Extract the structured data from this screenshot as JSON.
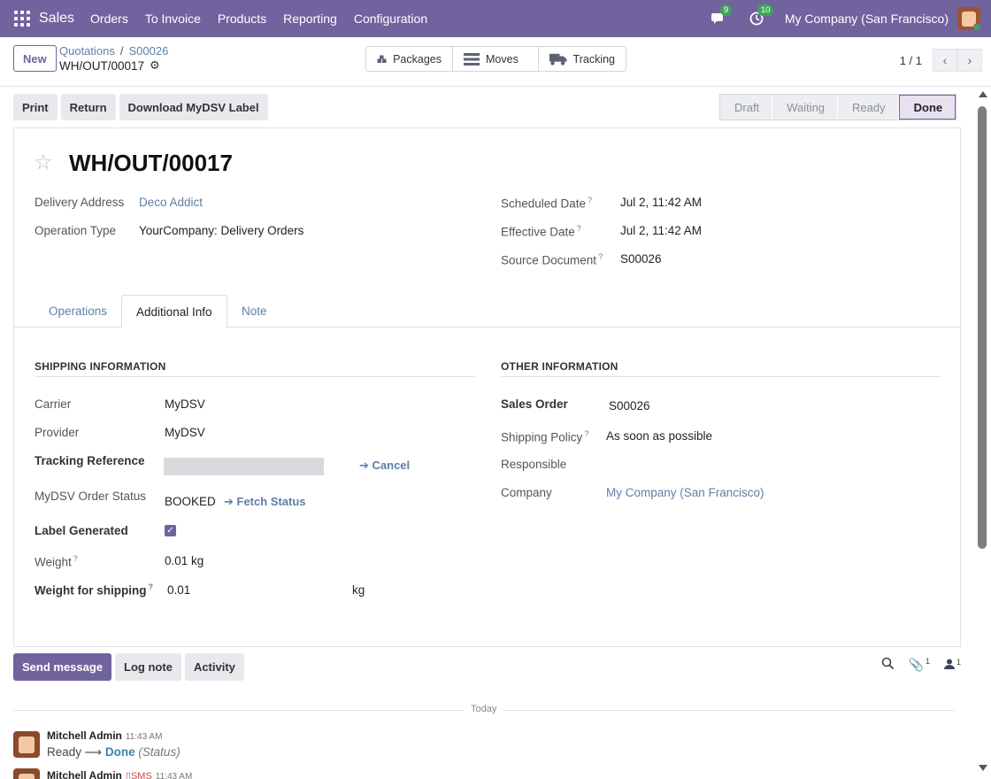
{
  "navbar": {
    "brand": "Sales",
    "items": [
      "Orders",
      "To Invoice",
      "Products",
      "Reporting",
      "Configuration"
    ],
    "messages_badge": "9",
    "activities_badge": "10",
    "company": "My Company (San Francisco)"
  },
  "control": {
    "new_label": "New",
    "breadcrumb": [
      "Quotations",
      "S00026"
    ],
    "record": "WH/OUT/00017",
    "smart_buttons": [
      {
        "label": "Packages",
        "icon": "packages-icon"
      },
      {
        "label": "Moves",
        "icon": "list-icon"
      },
      {
        "label": "Tracking",
        "icon": "truck-icon"
      }
    ],
    "pager": "1 / 1"
  },
  "actions": {
    "buttons": [
      "Print",
      "Return",
      "Download MyDSV Label"
    ],
    "stages": [
      "Draft",
      "Waiting",
      "Ready",
      "Done"
    ],
    "current_stage": "Done"
  },
  "form": {
    "name": "WH/OUT/00017",
    "delivery_address_label": "Delivery Address",
    "delivery_address": "Deco Addict",
    "operation_type_label": "Operation Type",
    "operation_type": "YourCompany: Delivery Orders",
    "scheduled_date_label": "Scheduled Date",
    "scheduled_date": "Jul 2, 11:42 AM",
    "effective_date_label": "Effective Date",
    "effective_date": "Jul 2, 11:42 AM",
    "source_document_label": "Source Document",
    "source_document": "S00026"
  },
  "tabs": [
    "Operations",
    "Additional Info",
    "Note"
  ],
  "shipping": {
    "title": "SHIPPING INFORMATION",
    "carrier_label": "Carrier",
    "carrier": "MyDSV",
    "provider_label": "Provider",
    "provider": "MyDSV",
    "tracking_label": "Tracking Reference",
    "cancel_label": "Cancel",
    "order_status_label": "MyDSV Order Status",
    "order_status": "BOOKED",
    "fetch_label": "Fetch Status",
    "label_generated_label": "Label Generated",
    "weight_label": "Weight",
    "weight": "0.01",
    "weight_unit": "kg",
    "weight_shipping_label": "Weight for shipping",
    "weight_shipping": "0.01",
    "weight_shipping_unit": "kg"
  },
  "other": {
    "title": "OTHER INFORMATION",
    "sales_order_label": "Sales Order",
    "sales_order": "S00026",
    "shipping_policy_label": "Shipping Policy",
    "shipping_policy": "As soon as possible",
    "responsible_label": "Responsible",
    "company_label": "Company",
    "company": "My Company (San Francisco)"
  },
  "chatter": {
    "send_message": "Send message",
    "log_note": "Log note",
    "activity": "Activity",
    "attachments_count": "1",
    "followers_count": "1",
    "today": "Today",
    "msg1_author": "Mitchell Admin",
    "msg1_time": "11:43 AM",
    "msg1_old": "Ready",
    "msg1_new": "Done",
    "msg1_field": "(Status)",
    "msg2_author": "Mitchell Admin",
    "msg2_sms": "SMS",
    "msg2_time": "11:43 AM"
  }
}
